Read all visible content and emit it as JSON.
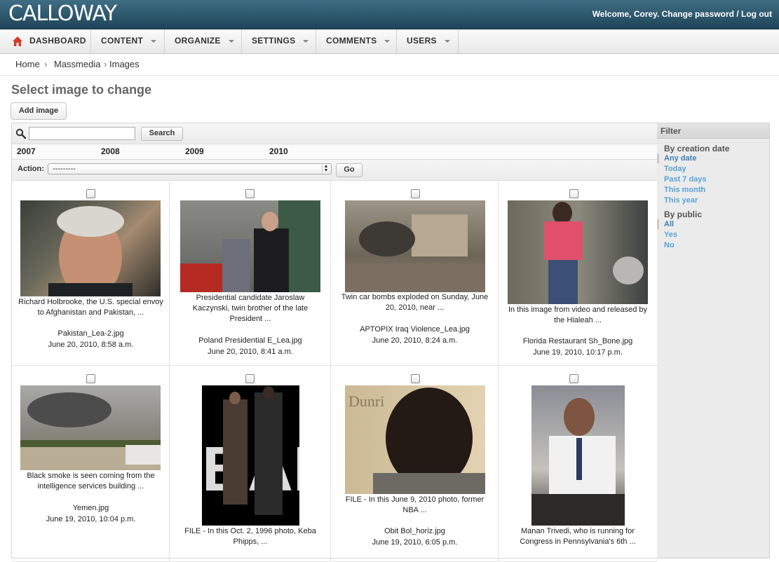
{
  "header": {
    "logo": "CALLOWAY",
    "welcome": "Welcome, Corey.",
    "change_password": "Change password",
    "separator": "/",
    "logout": "Log out"
  },
  "nav": {
    "dashboard": "DASHBOARD",
    "content": "CONTENT",
    "organize": "ORGANIZE",
    "settings": "SETTINGS",
    "comments": "COMMENTS",
    "users": "USERS"
  },
  "breadcrumb": {
    "home": "Home",
    "sep1": "›",
    "massmedia": "Massmedia",
    "sep2": "›",
    "images": "Images"
  },
  "page": {
    "title": "Select image to change",
    "add_button": "Add image"
  },
  "search": {
    "value": "",
    "button": "Search"
  },
  "date_hierarchy": [
    "2007",
    "2008",
    "2009",
    "2010"
  ],
  "actions": {
    "label": "Action:",
    "selected": "---------",
    "go": "Go"
  },
  "images": [
    {
      "caption": "Richard Holbrooke, the U.S. special envoy to Afghanistan and Pakistan, ...",
      "file": "Pakistan_Lea-2.jpg",
      "date": "June 20, 2010, 8:58 a.m."
    },
    {
      "caption": "Presidential candidate Jaroslaw Kaczynski, twin brother of the late President ...",
      "file": "Poland Presidential E_Lea.jpg",
      "date": "June 20, 2010, 8:41 a.m."
    },
    {
      "caption": "Twin car bombs exploded on Sunday, June 20, 2010, near ...",
      "file": "APTOPIX Iraq Violence_Lea.jpg",
      "date": "June 20, 2010, 8:24 a.m."
    },
    {
      "caption": "In this image from video and released by the Hialeah ...",
      "file": "Florida Restaurant Sh_Bone.jpg",
      "date": "June 19, 2010, 10:17 p.m."
    },
    {
      "caption": "Black smoke is seen coming from the intelligence services building ...",
      "file": "Yemen.jpg",
      "date": "June 19, 2010, 10:04 p.m."
    },
    {
      "caption": "FILE - In this Oct. 2, 1996 photo, Keba Phipps, ...",
      "file": "",
      "date": ""
    },
    {
      "caption": "FILE - In this June 9, 2010 photo, former NBA ...",
      "file": "Obit Bol_horiz.jpg",
      "date": "June 19, 2010, 6:05 p.m."
    },
    {
      "caption": "Manan Trivedi, who is running for Congress in Pennsylvania's 6th ...",
      "file": "",
      "date": ""
    }
  ],
  "filter": {
    "title": "Filter",
    "creation_title": "By creation date",
    "creation_options": [
      "Any date",
      "Today",
      "Past 7 days",
      "This month",
      "This year"
    ],
    "public_title": "By public",
    "public_options": [
      "All",
      "Yes",
      "No"
    ]
  }
}
